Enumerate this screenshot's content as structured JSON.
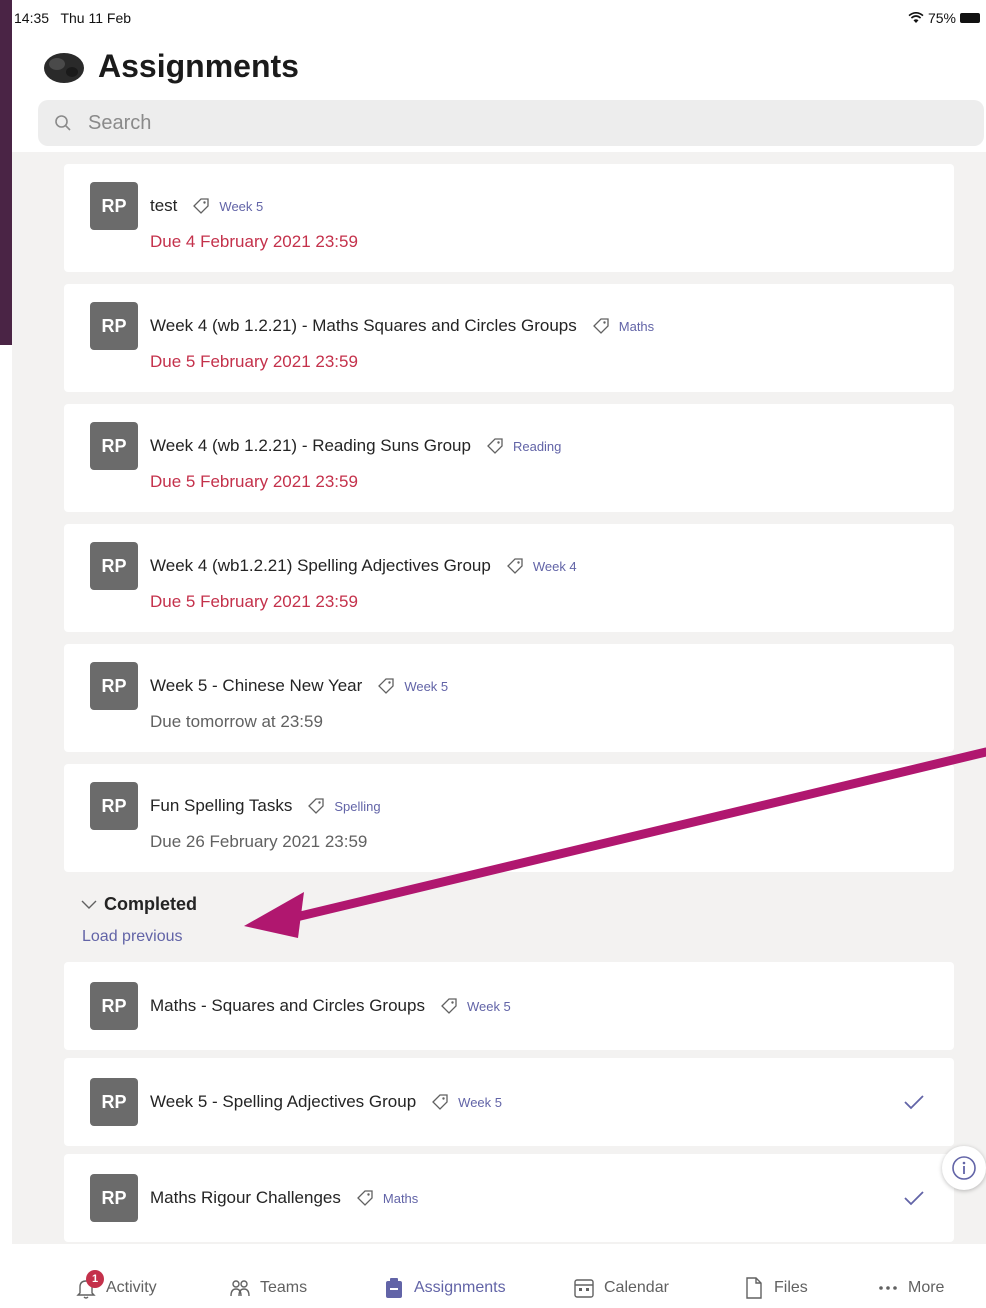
{
  "status_bar": {
    "time": "14:35",
    "date": "Thu 11 Feb",
    "battery": "75%"
  },
  "header": {
    "title": "Assignments"
  },
  "search": {
    "placeholder": "Search"
  },
  "avatar_initials": "RP",
  "assignments": [
    {
      "title": "test",
      "tag": "Week 5",
      "due": "Due 4 February 2021 23:59",
      "due_status": "late"
    },
    {
      "title": "Week 4 (wb 1.2.21) - Maths Squares and Circles Groups",
      "tag": "Maths",
      "due": "Due 5 February 2021 23:59",
      "due_status": "late"
    },
    {
      "title": "Week 4 (wb 1.2.21) - Reading Suns Group",
      "tag": "Reading",
      "due": "Due 5 February 2021 23:59",
      "due_status": "late"
    },
    {
      "title": "Week 4 (wb1.2.21) Spelling Adjectives Group",
      "tag": "Week 4",
      "due": "Due 5 February 2021 23:59",
      "due_status": "late"
    },
    {
      "title": "Week 5 - Chinese New Year",
      "tag": "Week 5",
      "due": "Due tomorrow at 23:59",
      "due_status": "upcoming"
    },
    {
      "title": "Fun Spelling Tasks",
      "tag": "Spelling",
      "due": "Due 26 February 2021 23:59",
      "due_status": "upcoming"
    }
  ],
  "completed_section": {
    "label": "Completed",
    "load_previous": "Load previous"
  },
  "completed": [
    {
      "title": "Maths - Squares and Circles Groups",
      "tag": "Week 5",
      "checked": false
    },
    {
      "title": "Week 5 - Spelling Adjectives Group",
      "tag": "Week 5",
      "checked": true
    },
    {
      "title": "Maths Rigour Challenges",
      "tag": "Maths",
      "checked": true
    }
  ],
  "bottom_nav": {
    "items": [
      {
        "label": "Activity",
        "icon": "bell-icon",
        "badge": "1"
      },
      {
        "label": "Teams",
        "icon": "teams-icon"
      },
      {
        "label": "Assignments",
        "icon": "assignments-icon",
        "active": true
      },
      {
        "label": "Calendar",
        "icon": "calendar-icon"
      },
      {
        "label": "Files",
        "icon": "file-icon"
      },
      {
        "label": "More",
        "icon": "ellipsis-icon"
      }
    ]
  },
  "colors": {
    "accent": "#6264a7",
    "late": "#c4314b",
    "avatar_bg": "#6b6b6b",
    "annotation_arrow": "#b0176f",
    "frame": "#4a2445"
  }
}
